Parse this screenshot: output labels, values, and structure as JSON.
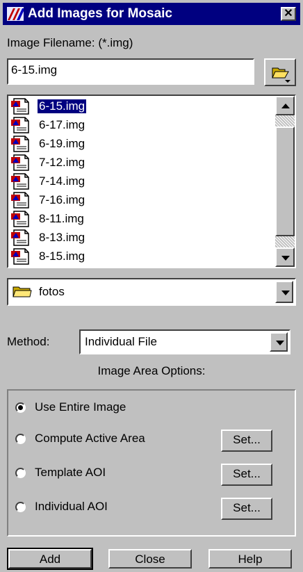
{
  "window": {
    "title": "Add Images for Mosaic",
    "close_glyph": "✕"
  },
  "filename": {
    "label": "Image Filename: (*.img)",
    "value": "6-15.img"
  },
  "file_list": {
    "items": [
      "6-15.img",
      "6-17.img",
      "6-19.img",
      "7-12.img",
      "7-14.img",
      "7-16.img",
      "8-11.img",
      "8-13.img",
      "8-15.img"
    ],
    "selected": "6-15.img"
  },
  "directory": {
    "value": "fotos"
  },
  "method": {
    "label": "Method:",
    "value": "Individual File"
  },
  "area_options": {
    "heading": "Image Area Options:",
    "options": [
      {
        "label": "Use Entire Image",
        "checked": true
      },
      {
        "label": "Compute Active Area",
        "checked": false,
        "button": "Set..."
      },
      {
        "label": "Template AOI",
        "checked": false,
        "button": "Set..."
      },
      {
        "label": "Individual AOI",
        "checked": false,
        "button": "Set..."
      }
    ]
  },
  "actions": {
    "add": "Add",
    "close": "Close",
    "help": "Help"
  },
  "colors": {
    "titlebar": "#000080",
    "face": "#c0c0c0",
    "selection": "#000080"
  }
}
